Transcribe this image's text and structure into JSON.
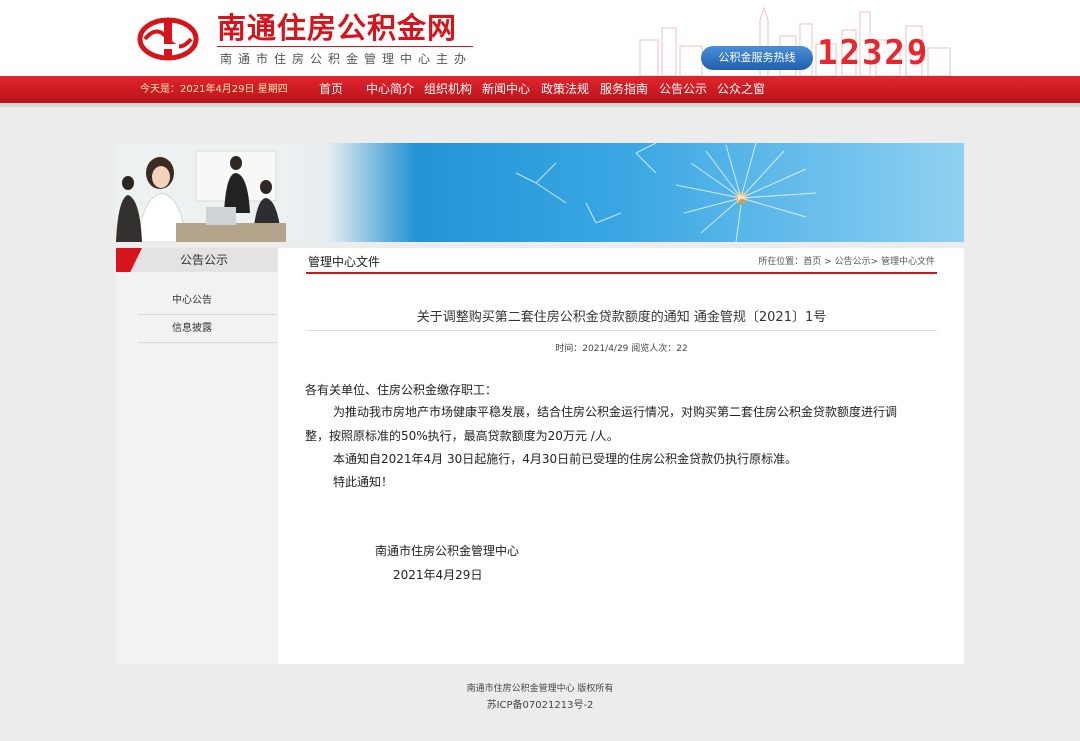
{
  "header": {
    "site_title": "南通住房公积金网",
    "site_subtitle": "南通市住房公积金管理中心主办",
    "hotline_label": "公积金服务热线",
    "hotline_number": "12329"
  },
  "nav": {
    "today": "今天是：2021年4月29日 星期四",
    "items": [
      "首页",
      "中心简介",
      "组织机构",
      "新闻中心",
      "政策法规",
      "服务指南",
      "公告公示",
      "公众之窗"
    ]
  },
  "sidebar": {
    "title": "公告公示",
    "items": [
      "中心公告",
      "信息披露"
    ]
  },
  "content": {
    "section_title": "管理中心文件",
    "breadcrumb": {
      "prefix": "所在位置：",
      "home": "首页",
      "sep": " > ",
      "level1": "公告公示",
      "sep2": "> ",
      "current": "管理中心文件"
    },
    "article": {
      "title": "关于调整购买第二套住房公积金贷款额度的通知 通金管规〔2021〕1号",
      "meta": "时间：2021/4/29   阅览人次：22",
      "salutation": "各有关单位、住房公积金缴存职工：",
      "para1_line1": "为推动我市房地产市场健康平稳发展，结合住房公积金运行情况，对购买第二套住房公积金贷款额度进行调",
      "para1_line2": "整，按照原标准的50%执行，最高贷款额度为20万元 /人。",
      "para2": "本通知自2021年4月 30日起施行，4月30日前已受理的住房公积金贷款仍执行原标准。",
      "para3": "特此通知！",
      "signature_org": "南通市住房公积金管理中心",
      "signature_date": "2021年4月29日"
    }
  },
  "footer": {
    "line1": "南通市住房公积金管理中心   版权所有",
    "line2": "苏ICP备07021213号-2"
  },
  "colors": {
    "brand_red": "#d7141b",
    "hotline_blue": "#2a6bbd",
    "page_bg": "#ececec"
  }
}
